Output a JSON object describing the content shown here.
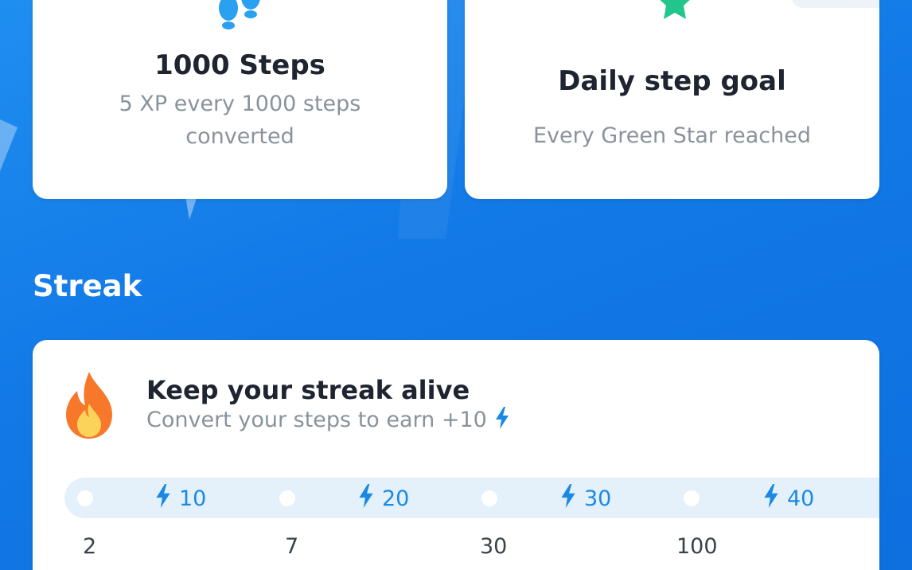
{
  "cards": [
    {
      "icon": "footsteps-icon",
      "title": "1000 Steps",
      "description": "5 XP every 1000 steps converted"
    },
    {
      "icon": "green-star-icon",
      "title": "Daily step goal",
      "description": "Every Green Star reached"
    }
  ],
  "streak": {
    "heading": "Streak",
    "title": "Keep your streak alive",
    "subtitle": "Convert your steps to earn +10",
    "icon": "flame-icon",
    "milestones": [
      {
        "reward": "10",
        "day": "2"
      },
      {
        "reward": "20",
        "day": "7"
      },
      {
        "reward": "30",
        "day": "30"
      },
      {
        "reward": "40",
        "day": "100"
      }
    ]
  },
  "colors": {
    "background": "#1279e6",
    "accent": "#1989e4",
    "star": "#22c58b",
    "flame": "#f7782a",
    "footsteps": "#29a0f0",
    "progress_track": "#e4f1fb"
  }
}
